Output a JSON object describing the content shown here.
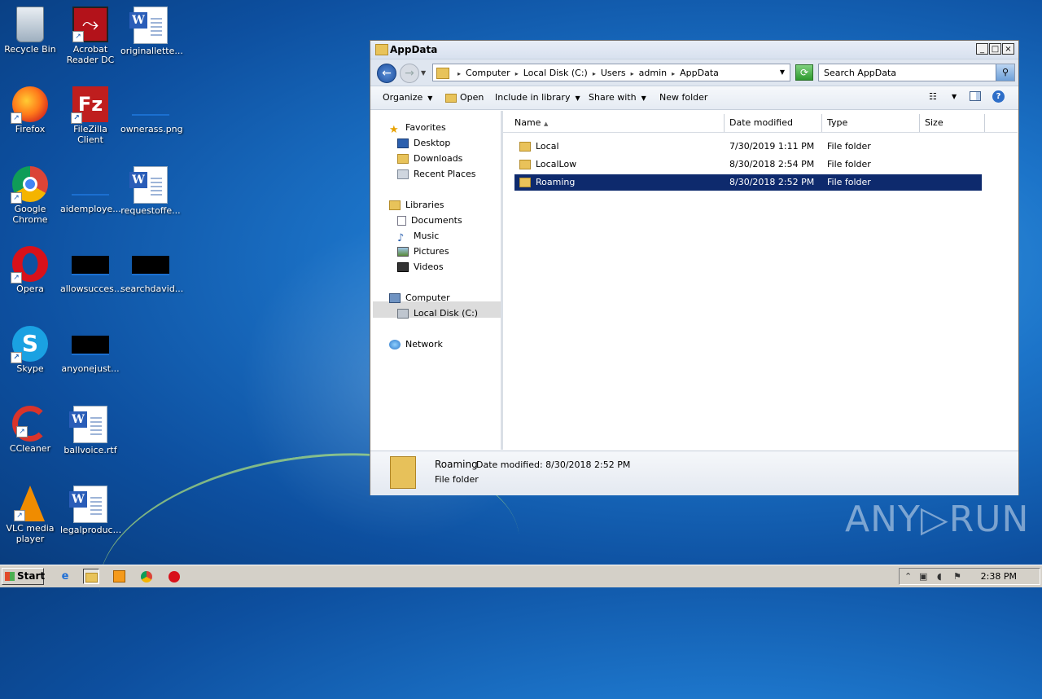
{
  "desktop": {
    "icons": [
      {
        "label": "Recycle Bin",
        "icon": "recycle-bin-icon"
      },
      {
        "label": "Acrobat Reader DC",
        "icon": "acrobat-icon"
      },
      {
        "label": "originallette...",
        "icon": "word-document-icon"
      },
      {
        "label": "Firefox",
        "icon": "firefox-icon"
      },
      {
        "label": "FileZilla Client",
        "icon": "filezilla-icon"
      },
      {
        "label": "ownerass.png",
        "icon": "image-file-icon"
      },
      {
        "label": "Google Chrome",
        "icon": "chrome-icon"
      },
      {
        "label": "aidemploye...",
        "icon": "image-file-icon"
      },
      {
        "label": "requestoffe...",
        "icon": "word-document-icon"
      },
      {
        "label": "Opera",
        "icon": "opera-icon"
      },
      {
        "label": "allowsucces...",
        "icon": "image-file-icon"
      },
      {
        "label": "searchdavid...",
        "icon": "image-file-icon"
      },
      {
        "label": "Skype",
        "icon": "skype-icon"
      },
      {
        "label": "anyonejust...",
        "icon": "image-file-icon"
      },
      {
        "label": "CCleaner",
        "icon": "ccleaner-icon"
      },
      {
        "label": "ballvoice.rtf",
        "icon": "word-document-icon"
      },
      {
        "label": "VLC media player",
        "icon": "vlc-icon"
      },
      {
        "label": "legalproduc...",
        "icon": "word-document-icon"
      }
    ]
  },
  "window": {
    "title": "AppData",
    "controls": {
      "minimize": "_",
      "maximize": "□",
      "close": "×"
    },
    "breadcrumb": [
      "Computer",
      "Local Disk (C:)",
      "Users",
      "admin",
      "AppData"
    ],
    "search_placeholder": "Search AppData",
    "toolbar": {
      "organize": "Organize",
      "open": "Open",
      "include_in_library": "Include in library",
      "share_with": "Share with",
      "new_folder": "New folder"
    },
    "nav": {
      "favorites": "Favorites",
      "desktop": "Desktop",
      "downloads": "Downloads",
      "recent_places": "Recent Places",
      "libraries": "Libraries",
      "documents": "Documents",
      "music": "Music",
      "pictures": "Pictures",
      "videos": "Videos",
      "computer": "Computer",
      "local_disk": "Local Disk (C:)",
      "network": "Network"
    },
    "columns": {
      "name": "Name",
      "date_modified": "Date modified",
      "type": "Type",
      "size": "Size"
    },
    "files": [
      {
        "name": "Local",
        "date": "7/30/2019 1:11 PM",
        "type": "File folder",
        "size": ""
      },
      {
        "name": "LocalLow",
        "date": "8/30/2018 2:54 PM",
        "type": "File folder",
        "size": ""
      },
      {
        "name": "Roaming",
        "date": "8/30/2018 2:52 PM",
        "type": "File folder",
        "size": "",
        "selected": true
      }
    ],
    "details": {
      "name": "Roaming",
      "date_label": "Date modified: 8/30/2018 2:52 PM",
      "type": "File folder"
    }
  },
  "watermark": "ANY▷RUN",
  "taskbar": {
    "start": "Start",
    "clock": "2:38 PM"
  },
  "colors": {
    "selection": "#0e2a6d",
    "desktop": "#1c74c9"
  }
}
